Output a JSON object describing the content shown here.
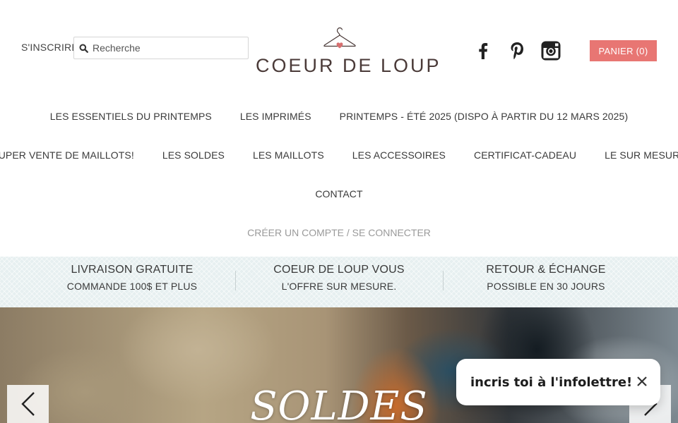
{
  "header": {
    "signup_label": "S'INSCRIRE",
    "search": {
      "placeholder": "Recherche",
      "icon": "search-icon"
    },
    "logo": {
      "text": "COEUR DE LOUP",
      "icon": "hanger-heart-icon",
      "heart_color": "#d77070"
    },
    "social": [
      {
        "name": "facebook-icon"
      },
      {
        "name": "pinterest-icon"
      },
      {
        "name": "instagram-icon"
      }
    ],
    "cart_label": "PANIER (0)",
    "accent_color": "#e87673"
  },
  "nav": {
    "row1": [
      "LES ESSENTIELS DU PRINTEMPS",
      "LES IMPRIMÉS",
      "PRINTEMPS - ÉTÉ 2025 (DISPO À PARTIR DU 12 MARS 2025)"
    ],
    "row2": [
      "SUPER VENTE DE MAILLOTS!",
      "LES SOLDES",
      "LES MAILLOTS",
      "LES ACCESSOIRES",
      "CERTIFICAT-CADEAU",
      "LE SUR MESURE"
    ],
    "row3": [
      "CONTACT"
    ],
    "account": {
      "create": "CRÉER UN COMPTE",
      "separator": "/",
      "login": "SE CONNECTER"
    }
  },
  "features": [
    {
      "title": "LIVRAISON GRATUITE",
      "subtitle": "COMMANDE 100$ ET PLUS"
    },
    {
      "title": "COEUR DE LOUP VOUS",
      "subtitle": "L'OFFRE SUR MESURE."
    },
    {
      "title": "RETOUR & ÉCHANGE",
      "subtitle": "POSSIBLE EN 30 JOURS"
    }
  ],
  "hero": {
    "title": "SOLDES",
    "prev_icon": "chevron-left-icon",
    "next_icon": "chevron-right-icon"
  },
  "popup": {
    "message": "incris toi à l'infolettre!",
    "close_icon": "close-icon"
  }
}
